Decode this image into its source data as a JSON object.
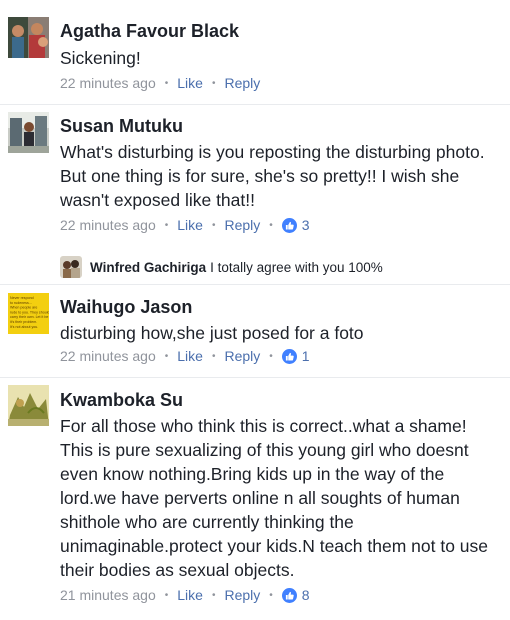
{
  "colors": {
    "link": "#4b6fad",
    "meta": "#90949c",
    "like_badge": "#4080ff"
  },
  "comments": [
    {
      "author": "Agatha Favour Black",
      "text": "Sickening!",
      "time": "22 minutes ago",
      "like_label": "Like",
      "reply_label": "Reply"
    },
    {
      "author": "Susan Mutuku",
      "text": "What's disturbing is you reposting the disturbing photo. But one thing is for sure,  she's so pretty!!  I wish she wasn't exposed like that!!",
      "time": "22 minutes ago",
      "like_label": "Like",
      "reply_label": "Reply",
      "likes": "3",
      "reply": {
        "author": "Winfred Gachiriga",
        "text": "I totally agree with you 100%"
      }
    },
    {
      "author": "Waihugo Jason",
      "text": "disturbing how,she just posed for a foto",
      "time": "22 minutes ago",
      "like_label": "Like",
      "reply_label": "Reply",
      "likes": "1",
      "avatar_text": [
        "Never respond",
        "to rudeness...",
        "When people are",
        "rude to you. They should",
        "carry their own. Let it be",
        "it's their problem.",
        "It's not about you."
      ]
    },
    {
      "author": "Kwamboka Su",
      "text": "For all those who think this is correct..what a shame! This is pure sexualizing of this young girl who doesnt even know nothing.Bring kids up in the way of the lord.we have perverts online n all soughts of human shithole who are currently thinking the unimaginable.protect your kids.N teach them not to use their bodies as sexual objects.",
      "time": "21 minutes ago",
      "like_label": "Like",
      "reply_label": "Reply",
      "likes": "8"
    }
  ]
}
